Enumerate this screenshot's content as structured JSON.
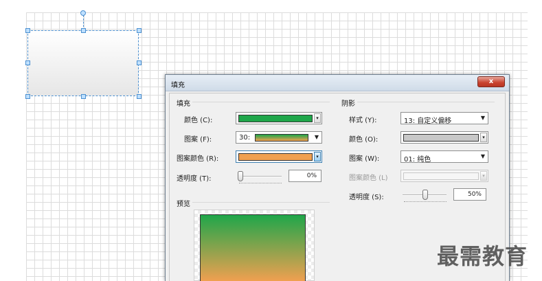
{
  "dialog": {
    "title": "填充",
    "close_label": "x"
  },
  "fill": {
    "section_label": "填充",
    "color_label": "颜色 (C):",
    "color_value": "#1fa64a",
    "pattern_label": "图案 (F):",
    "pattern_value": "30:",
    "pattern_color_label": "图案颜色 (R):",
    "pattern_color_value": "#f0a050",
    "transparency_label": "透明度 (T):",
    "transparency_value": "0%",
    "transparency_fraction": 0.0
  },
  "shadow": {
    "section_label": "阴影",
    "style_label": "样式 (Y):",
    "style_value": "13: 自定义偏移",
    "color_label": "颜色 (O):",
    "color_value": "#c8c8c8",
    "pattern_label": "图案 (W):",
    "pattern_value": "01: 纯色",
    "pattern_color_label": "图案颜色 (L)",
    "transparency_label": "透明度 (S):",
    "transparency_value": "50%",
    "transparency_fraction": 0.5
  },
  "preview": {
    "section_label": "预览",
    "gradient_top": "#1fa64a",
    "gradient_bottom": "#f0a050"
  },
  "watermark": {
    "text": "最需教育"
  }
}
